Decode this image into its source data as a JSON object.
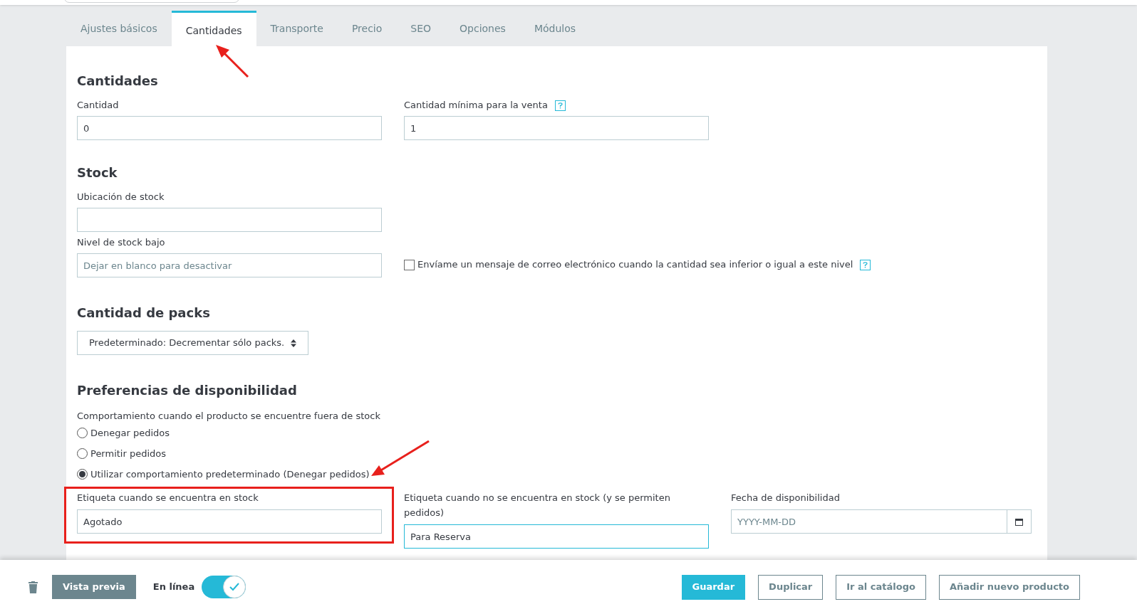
{
  "tabs": [
    {
      "label": "Ajustes básicos",
      "selected": false
    },
    {
      "label": "Cantidades",
      "selected": true
    },
    {
      "label": "Transporte",
      "selected": false
    },
    {
      "label": "Precio",
      "selected": false
    },
    {
      "label": "SEO",
      "selected": false
    },
    {
      "label": "Opciones",
      "selected": false
    },
    {
      "label": "Módulos",
      "selected": false
    }
  ],
  "quantities": {
    "title": "Cantidades",
    "quantity": {
      "label": "Cantidad",
      "value": "0"
    },
    "minimum": {
      "label": "Cantidad mínima para la venta",
      "value": "1"
    }
  },
  "stock": {
    "title": "Stock",
    "location": {
      "label": "Ubicación de stock"
    },
    "low_level": {
      "label": "Nivel de stock bajo",
      "placeholder": "Dejar en blanco para desactivar"
    },
    "email_alert": {
      "label": "Envíame un mensaje de correo electrónico cuando la cantidad sea inferior o igual a este nivel",
      "checked": false
    }
  },
  "packs": {
    "title": "Cantidad de packs",
    "select": {
      "value": "Predeterminado: Decrementar sólo packs."
    }
  },
  "availability": {
    "title": "Preferencias de disponibilidad",
    "behavior_label": "Comportamiento cuando el producto se encuentre fuera de stock",
    "options": [
      {
        "label": "Denegar pedidos",
        "selected": false
      },
      {
        "label": "Permitir pedidos",
        "selected": false
      },
      {
        "label": "Utilizar comportamiento predeterminado (Denegar pedidos)",
        "selected": true
      }
    ],
    "in_stock_label": {
      "label": "Etiqueta cuando se encuentra en stock",
      "value": "Agotado",
      "focused": false
    },
    "out_of_stock_label": {
      "label": "Etiqueta cuando no se encuentra en stock (y se permiten pedidos)",
      "value": "Para Reserva",
      "focused": true
    },
    "date": {
      "label": "Fecha de disponibilidad",
      "placeholder": "YYYY-MM-DD"
    }
  },
  "footer": {
    "preview": "Vista previa",
    "online": {
      "label": "En línea",
      "on": true
    },
    "buttons": [
      {
        "label": "Guardar",
        "kind": "primary"
      },
      {
        "label": "Duplicar",
        "kind": "secondary"
      },
      {
        "label": "Ir al catálogo",
        "kind": "secondary"
      },
      {
        "label": "Añadir nuevo producto",
        "kind": "secondary"
      }
    ]
  }
}
